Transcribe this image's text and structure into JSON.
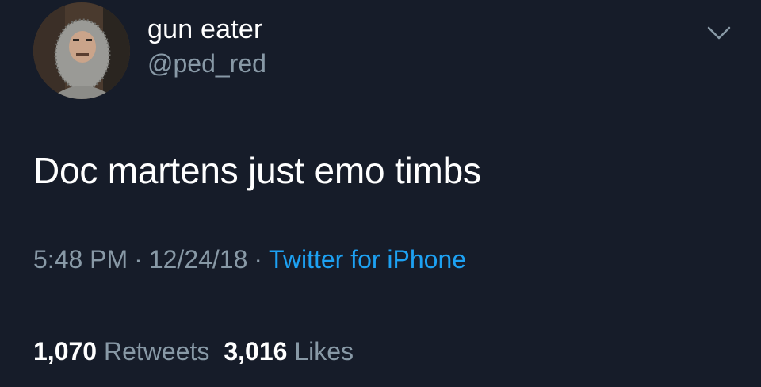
{
  "user": {
    "display_name": "gun eater",
    "handle": "@ped_red"
  },
  "tweet": {
    "text": "Doc martens just emo timbs",
    "time": "5:48 PM",
    "date": "12/24/18",
    "source": "Twitter for iPhone",
    "separator": "·"
  },
  "stats": {
    "retweets_count": "1,070",
    "retweets_label": "Retweets",
    "likes_count": "3,016",
    "likes_label": "Likes"
  },
  "icons": {
    "menu": "chevron-down-icon"
  },
  "colors": {
    "background": "#161c29",
    "primary_text": "#ffffff",
    "secondary_text": "#8899a6",
    "link": "#1da1f2",
    "divider": "#38444d"
  }
}
